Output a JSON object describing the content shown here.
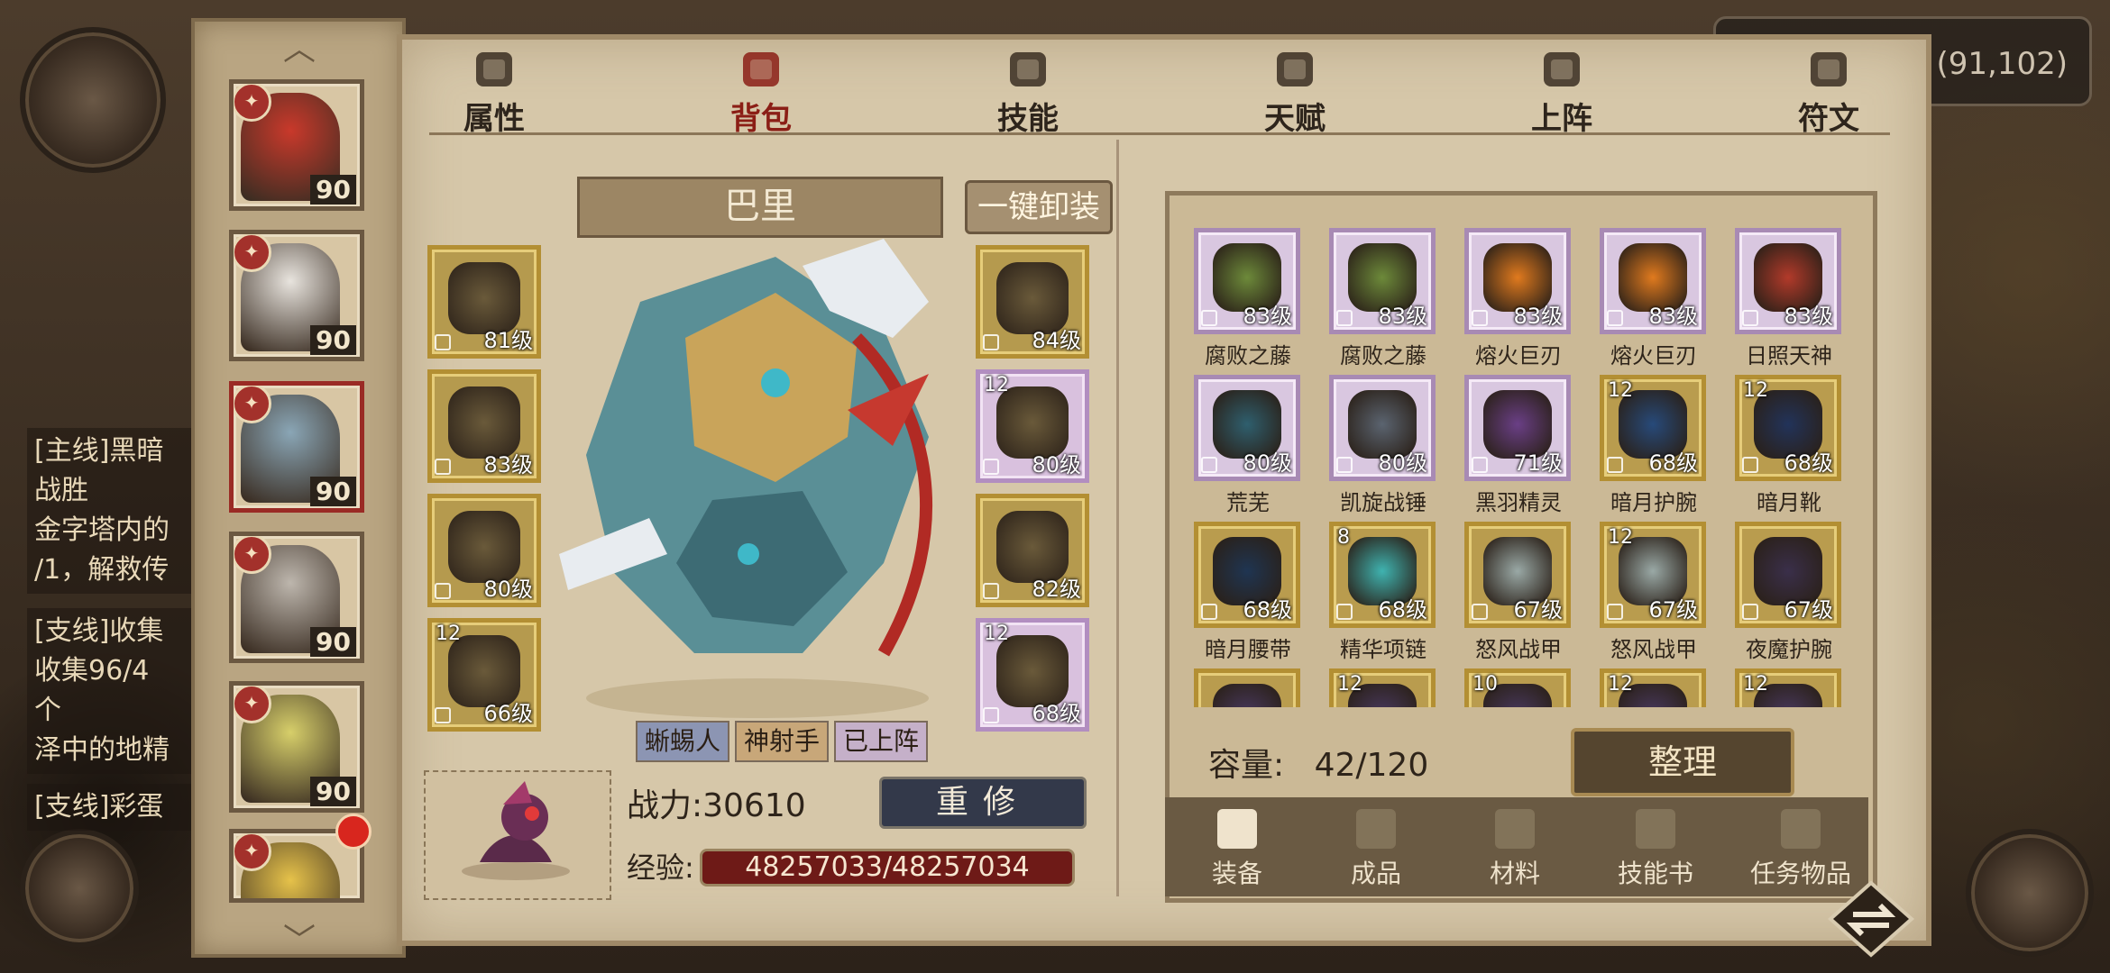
{
  "coords": "(91,102)",
  "quests": [
    {
      "head": "[主线]黑暗",
      "lines": [
        "战胜",
        "金字塔内的",
        "/1，解救传"
      ]
    },
    {
      "head": "[支线]收集",
      "lines": [
        "收集96/4",
        "个",
        "泽中的地精"
      ]
    },
    {
      "head": "[支线]彩蛋",
      "lines": []
    }
  ],
  "tabs": [
    {
      "label": "属性",
      "icon": "fire-icon"
    },
    {
      "label": "背包",
      "icon": "backpack-icon",
      "active": true
    },
    {
      "label": "技能",
      "icon": "book-icon"
    },
    {
      "label": "天赋",
      "icon": "eye-icon"
    },
    {
      "label": "上阵",
      "icon": "crossed-swords-icon"
    },
    {
      "label": "符文",
      "icon": "rune-icon"
    }
  ],
  "heroes": [
    {
      "level": "90",
      "color": "#c9392b"
    },
    {
      "level": "90",
      "color": "#e8e4de"
    },
    {
      "level": "90",
      "color": "#8aa6b6",
      "selected": true
    },
    {
      "level": "90",
      "color": "#bdb6ad"
    },
    {
      "level": "90",
      "color": "#d7cf6a"
    },
    {
      "level": "",
      "color": "#e6c24a"
    }
  ],
  "hero": {
    "name": "巴里",
    "unequip_label": "一键卸装",
    "tags": [
      "蜥蜴人",
      "神射手",
      "已上阵"
    ],
    "power": "战力:30610",
    "reforge_label": "重修",
    "exp_label": "经验:",
    "exp_value": "48257033/48257034"
  },
  "equip_left": [
    {
      "level": "81级",
      "plus": ""
    },
    {
      "level": "83级",
      "plus": ""
    },
    {
      "level": "80级",
      "plus": ""
    },
    {
      "level": "66级",
      "plus": "12"
    }
  ],
  "equip_right": [
    {
      "level": "84级",
      "plus": "",
      "purple": false
    },
    {
      "level": "80级",
      "plus": "12",
      "purple": true
    },
    {
      "level": "82级",
      "plus": "",
      "purple": false
    },
    {
      "level": "68级",
      "plus": "12",
      "purple": true
    }
  ],
  "items": [
    {
      "name": "腐败之藤",
      "level": "83级",
      "plus": "",
      "gold": false,
      "color": "#6d8a3a"
    },
    {
      "name": "腐败之藤",
      "level": "83级",
      "plus": "",
      "gold": false,
      "color": "#6d8a3a"
    },
    {
      "name": "熔火巨刃",
      "level": "83级",
      "plus": "",
      "gold": false,
      "color": "#e07a1e"
    },
    {
      "name": "熔火巨刃",
      "level": "83级",
      "plus": "",
      "gold": false,
      "color": "#e07a1e"
    },
    {
      "name": "日照天神",
      "level": "83级",
      "plus": "",
      "gold": false,
      "color": "#b23a2a"
    },
    {
      "name": "荒芜",
      "level": "80级",
      "plus": "",
      "gold": false,
      "color": "#2f5f6e"
    },
    {
      "name": "凯旋战锤",
      "level": "80级",
      "plus": "",
      "gold": false,
      "color": "#5b6470"
    },
    {
      "name": "黑羽精灵",
      "level": "71级",
      "plus": "",
      "gold": false,
      "color": "#6a3f86"
    },
    {
      "name": "暗月护腕",
      "level": "68级",
      "plus": "12",
      "gold": true,
      "color": "#274a7a"
    },
    {
      "name": "暗月靴",
      "level": "68级",
      "plus": "12",
      "gold": true,
      "color": "#22335a"
    },
    {
      "name": "暗月腰带",
      "level": "68级",
      "plus": "",
      "gold": true,
      "color": "#1f3552"
    },
    {
      "name": "精华项链",
      "level": "68级",
      "plus": "8",
      "gold": true,
      "color": "#3fb3b0"
    },
    {
      "name": "怒风战甲",
      "level": "67级",
      "plus": "",
      "gold": true,
      "color": "#9aa9a6"
    },
    {
      "name": "怒风战甲",
      "level": "67级",
      "plus": "12",
      "gold": true,
      "color": "#9aa9a6"
    },
    {
      "name": "夜魔护腕",
      "level": "67级",
      "plus": "",
      "gold": true,
      "color": "#3a2f4a"
    },
    {
      "name": "",
      "level": "",
      "plus": "",
      "gold": true,
      "color": "#4a3a62"
    },
    {
      "name": "",
      "level": "",
      "plus": "12",
      "gold": true,
      "color": "#4a3a62"
    },
    {
      "name": "",
      "level": "",
      "plus": "10",
      "gold": true,
      "color": "#4a3a62"
    },
    {
      "name": "",
      "level": "",
      "plus": "12",
      "gold": true,
      "color": "#4a3a62"
    },
    {
      "name": "",
      "level": "",
      "plus": "12",
      "gold": true,
      "color": "#4a3a62"
    }
  ],
  "bag": {
    "capacity_label": "容量:",
    "capacity_value": "42/120",
    "sort_label": "整理",
    "bottom_tabs": [
      {
        "label": "装备",
        "active": true,
        "icon": "equipment-icon"
      },
      {
        "label": "成品",
        "icon": "potion-icon"
      },
      {
        "label": "材料",
        "icon": "ore-icon"
      },
      {
        "label": "技能书",
        "icon": "scroll-icon"
      },
      {
        "label": "任务物品",
        "icon": "quest-scroll-icon"
      }
    ]
  }
}
